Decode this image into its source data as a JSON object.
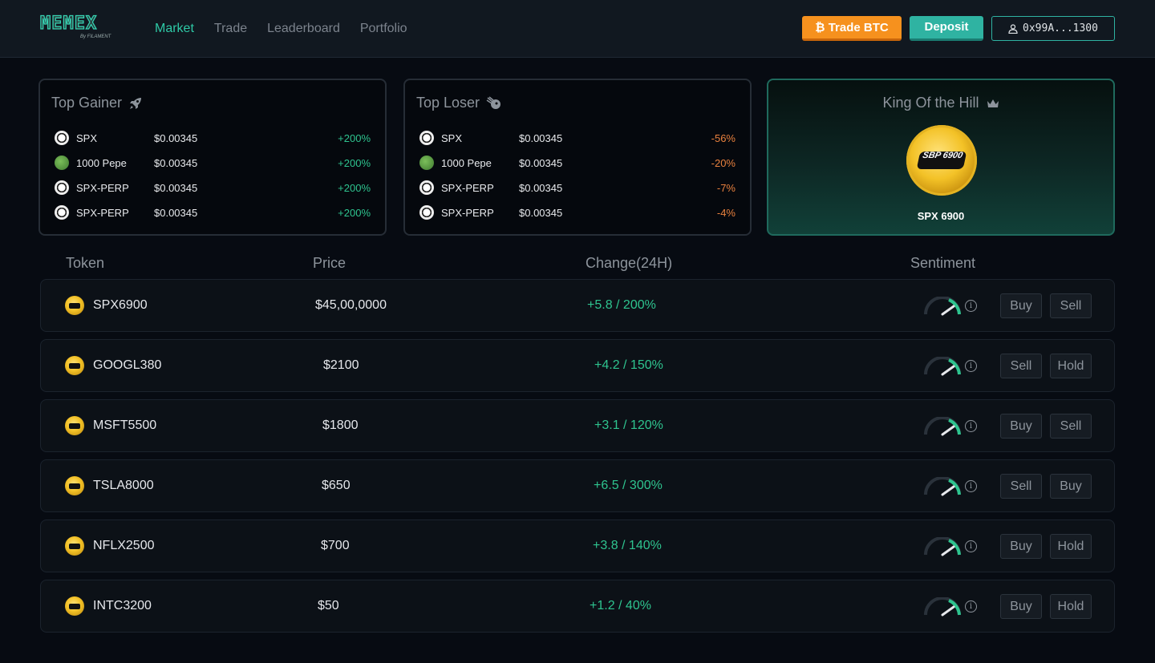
{
  "header": {
    "logo": "MEMEX",
    "logo_sub": "By FILAMENT",
    "nav": [
      "Market",
      "Trade",
      "Leaderboard",
      "Portfolio"
    ],
    "active_nav": "Market",
    "trade_btc_label": "Trade BTC",
    "deposit_label": "Deposit",
    "wallet": "0x99A...1300"
  },
  "top_gainer": {
    "title": "Top Gainer",
    "rows": [
      {
        "name": "SPX",
        "price": "$0.00345",
        "change": "+200%",
        "coin": "spx"
      },
      {
        "name": "1000 Pepe",
        "price": "$0.00345",
        "change": "+200%",
        "coin": "pepe"
      },
      {
        "name": "SPX-PERP",
        "price": "$0.00345",
        "change": "+200%",
        "coin": "spx"
      },
      {
        "name": "SPX-PERP",
        "price": "$0.00345",
        "change": "+200%",
        "coin": "spx"
      }
    ]
  },
  "top_loser": {
    "title": "Top Loser",
    "rows": [
      {
        "name": "SPX",
        "price": "$0.00345",
        "change": "-56%",
        "coin": "spx"
      },
      {
        "name": "1000 Pepe",
        "price": "$0.00345",
        "change": "-20%",
        "coin": "pepe"
      },
      {
        "name": "SPX-PERP",
        "price": "$0.00345",
        "change": "-7%",
        "coin": "spx"
      },
      {
        "name": "SPX-PERP",
        "price": "$0.00345",
        "change": "-4%",
        "coin": "spx"
      }
    ]
  },
  "king": {
    "title": "King Of the Hill",
    "coin_text": "SBP 6900",
    "name": "SPX 6900"
  },
  "table": {
    "headers": [
      "Token",
      "Price",
      "Change(24H)",
      "Sentiment"
    ],
    "rows": [
      {
        "token": "SPX6900",
        "price": "$45,00,0000",
        "change": "+5.8 / 200%",
        "actions": [
          "Buy",
          "Sell"
        ]
      },
      {
        "token": "GOOGL380",
        "price": "$2100",
        "change": "+4.2 / 150%",
        "actions": [
          "Sell",
          "Hold"
        ]
      },
      {
        "token": "MSFT5500",
        "price": "$1800",
        "change": "+3.1 / 120%",
        "actions": [
          "Buy",
          "Sell"
        ]
      },
      {
        "token": "TSLA8000",
        "price": "$650",
        "change": "+6.5 / 300%",
        "actions": [
          "Sell",
          "Buy"
        ]
      },
      {
        "token": "NFLX2500",
        "price": "$700",
        "change": "+3.8 / 140%",
        "actions": [
          "Buy",
          "Hold"
        ]
      },
      {
        "token": "INTC3200",
        "price": "$50",
        "change": "+1.2 / 40%",
        "actions": [
          "Buy",
          "Hold"
        ]
      }
    ]
  },
  "colors": {
    "accent": "#2ec9a6",
    "positive": "#2ec48f",
    "negative": "#e9813e",
    "btc": "#f6911e"
  }
}
